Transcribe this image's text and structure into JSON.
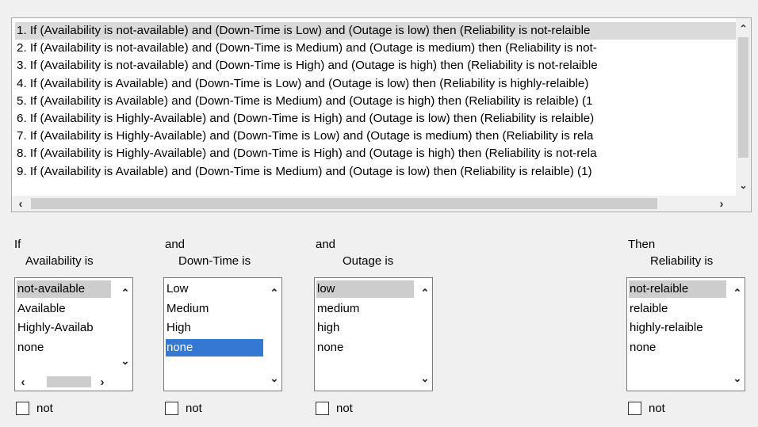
{
  "rules": [
    "1. If (Availability is not-available) and (Down-Time is Low) and (Outage is low) then (Reliability is not-relaible",
    "2. If (Availability is not-available) and (Down-Time is Medium) and (Outage is medium) then (Reliability is not-",
    "3. If (Availability is not-available) and (Down-Time is High) and (Outage is high) then (Reliability is not-relaible",
    "4. If (Availability is Available) and (Down-Time is Low) and (Outage is low) then (Reliability is highly-relaible)",
    "5. If (Availability is Available) and (Down-Time is Medium) and (Outage is high) then (Reliability is relaible) (1",
    "6. If (Availability is Highly-Available) and (Down-Time is High) and (Outage is low) then (Reliability is relaible)",
    "7. If (Availability is Highly-Available) and (Down-Time is Low) and (Outage is medium) then (Reliability is rela",
    "8. If (Availability is Highly-Available) and (Down-Time is High) and (Outage is high) then (Reliability is not-rela",
    "9. If (Availability is Available) and (Down-Time is Medium) and (Outage is low) then (Reliability is relaible) (1)"
  ],
  "selected_rule_index": 0,
  "icons": {
    "scroll_up": "chevron-up-icon",
    "scroll_down": "chevron-down-icon",
    "scroll_left": "chevron-left-icon",
    "scroll_right": "chevron-right-icon"
  },
  "columns": {
    "availability": {
      "connector": "If",
      "label": "Availability is",
      "items": [
        "not-available",
        "Available",
        "Highly-Availab",
        "none"
      ],
      "selected": "not-available",
      "not_label": "not"
    },
    "downtime": {
      "connector": "and",
      "label": "Down-Time is",
      "items": [
        "Low",
        "Medium",
        "High",
        "none"
      ],
      "selected": "none",
      "not_label": "not"
    },
    "outage": {
      "connector": "and",
      "label": "Outage is",
      "items": [
        "low",
        "medium",
        "high",
        "none"
      ],
      "selected": "low",
      "not_label": "not"
    },
    "reliability": {
      "connector": "Then",
      "label": "Reliability is",
      "items": [
        "not-relaible",
        "relaible",
        "highly-relaible",
        "none"
      ],
      "selected": "not-relaible",
      "not_label": "not"
    }
  },
  "colors": {
    "selection_blue": "#3478d4",
    "selection_gray": "#cdcdcd",
    "background": "#f0f0f0"
  }
}
